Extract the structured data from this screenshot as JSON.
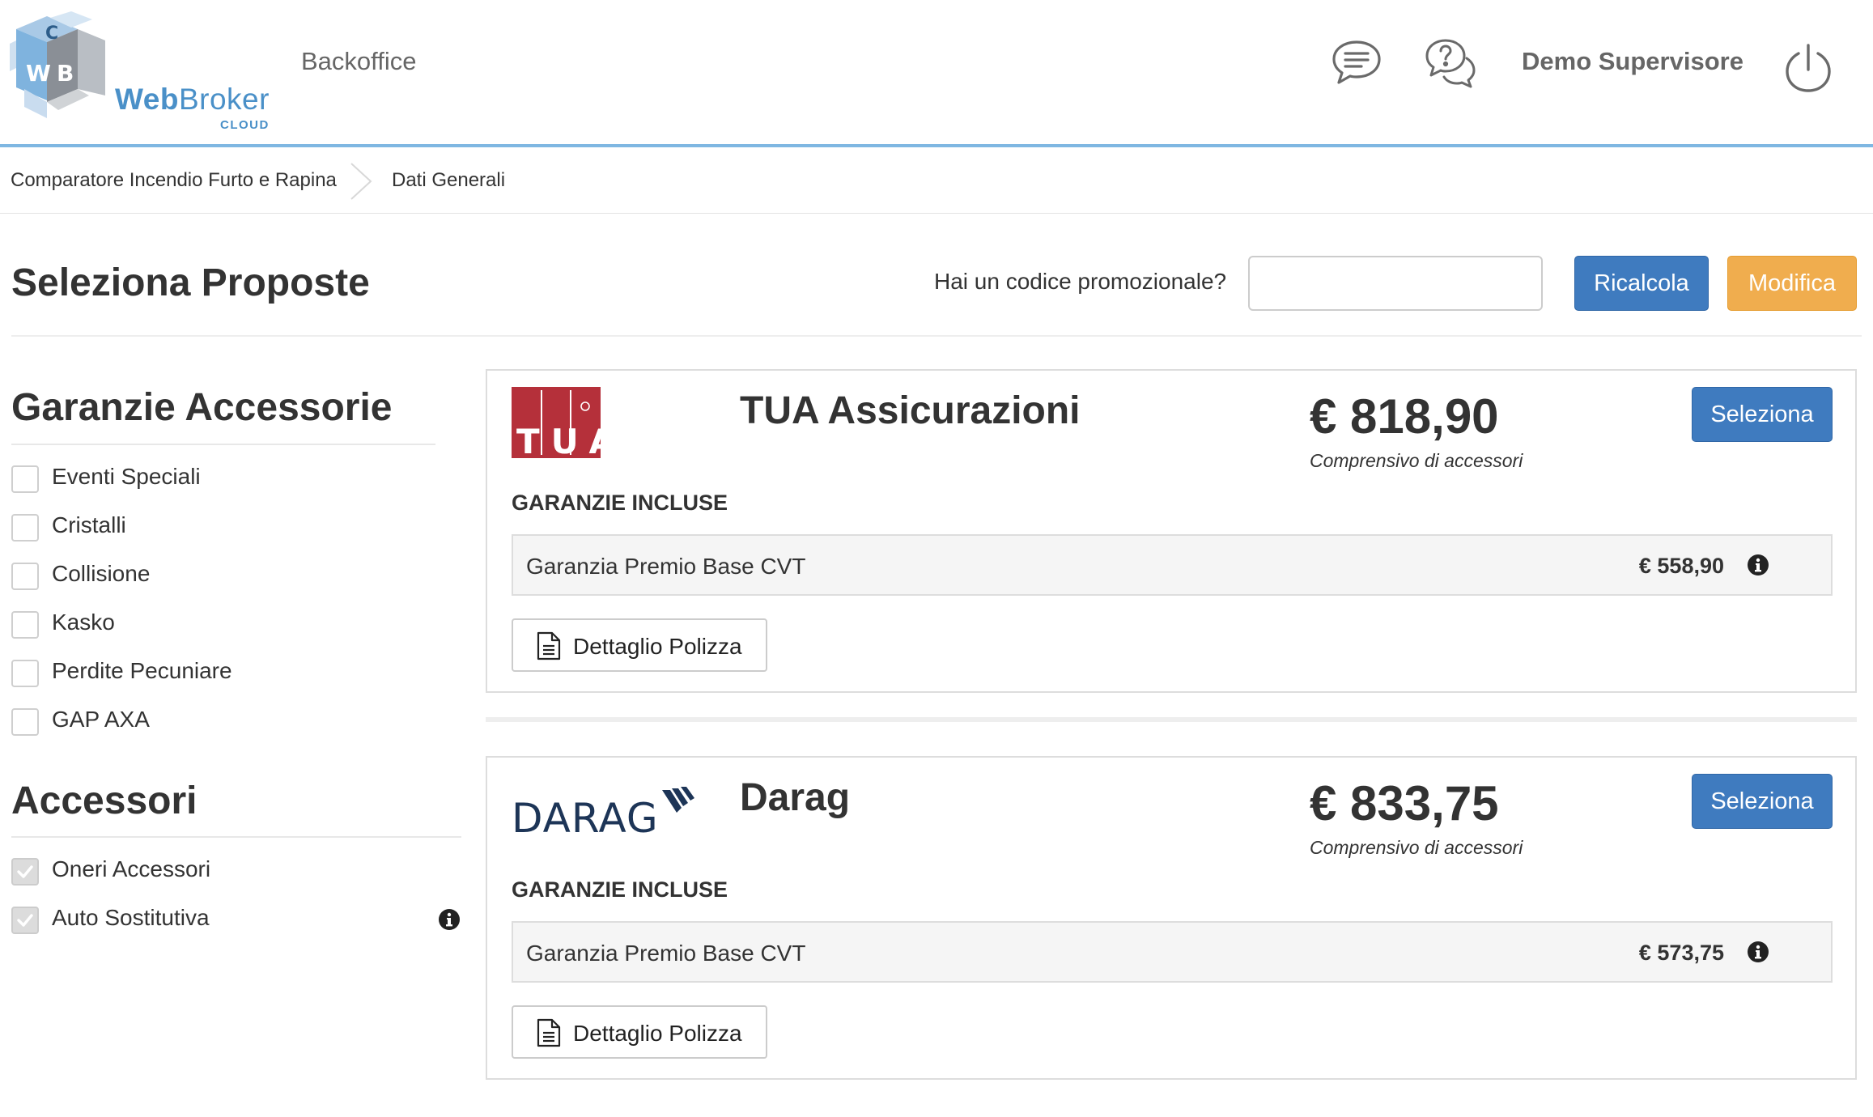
{
  "header": {
    "logo_text_bold": "Web",
    "logo_text_rest": "Broker",
    "logo_sub": "CLOUD",
    "logo_cube_letters": [
      "C",
      "W",
      "B"
    ],
    "section": "Backoffice",
    "user_name": "Demo Supervisore",
    "icons": [
      "chat-icon",
      "help-chat-icon",
      "power-icon"
    ]
  },
  "breadcrumb": {
    "items": [
      "Comparatore Incendio Furto e Rapina",
      "Dati Generali"
    ]
  },
  "title_bar": {
    "title": "Seleziona Proposte",
    "promo_label": "Hai un codice promozionale?",
    "promo_value": "",
    "promo_placeholder": "",
    "recalc_label": "Ricalcola",
    "modify_label": "Modifica"
  },
  "sidebar": {
    "guarantees_title": "Garanzie Accessorie",
    "guarantees": [
      {
        "label": "Eventi Speciali",
        "checked": false
      },
      {
        "label": "Cristalli",
        "checked": false
      },
      {
        "label": "Collisione",
        "checked": false
      },
      {
        "label": "Kasko",
        "checked": false
      },
      {
        "label": "Perdite Pecuniare",
        "checked": false
      },
      {
        "label": "GAP AXA",
        "checked": false
      }
    ],
    "accessories_title": "Accessori",
    "accessories": [
      {
        "label": "Oneri Accessori",
        "checked": true
      },
      {
        "label": "Auto Sostitutiva",
        "checked": true,
        "has_info": true
      }
    ]
  },
  "offers": [
    {
      "logo_text": "TUA",
      "company": "TUA Assicurazioni",
      "price": "€ 818,90",
      "price_note": "Comprensivo di accessori",
      "select_label": "Seleziona",
      "included_heading": "GARANZIE INCLUSE",
      "guarantees": [
        {
          "label": "Garanzia Premio Base CVT",
          "price": "€ 558,90"
        }
      ],
      "detail_label": "Dettaglio Polizza"
    },
    {
      "logo_text": "DARAG",
      "company": "Darag",
      "price": "€ 833,75",
      "price_note": "Comprensivo di accessori",
      "select_label": "Seleziona",
      "included_heading": "GARANZIE INCLUSE",
      "guarantees": [
        {
          "label": "Garanzia Premio Base CVT",
          "price": "€ 573,75"
        }
      ],
      "detail_label": "Dettaglio Polizza"
    }
  ],
  "colors": {
    "primary": "#3f7bbf",
    "warning": "#f0ad4e",
    "header_rule": "#7fb7e2",
    "tua_red": "#b5303a",
    "darag_navy": "#1d3557"
  }
}
